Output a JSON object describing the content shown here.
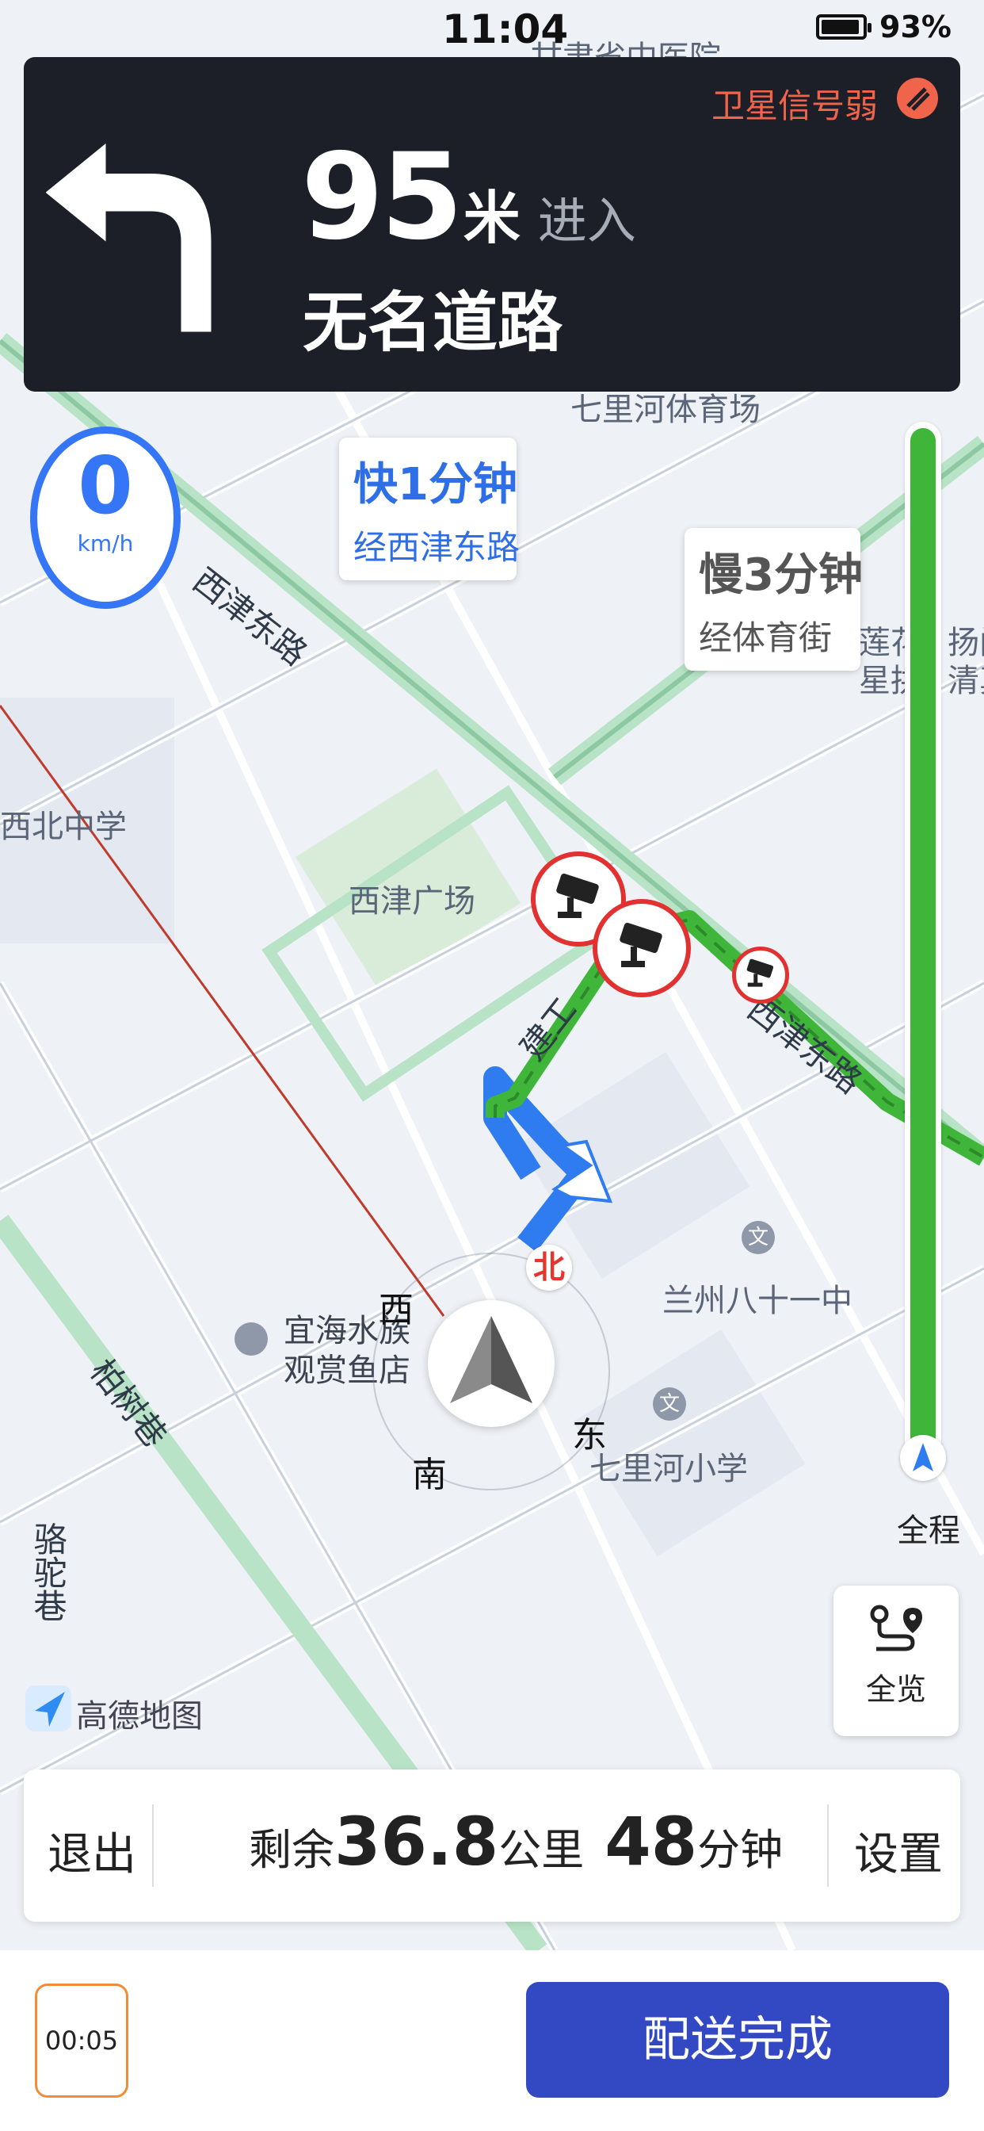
{
  "status_bar": {
    "time": "11:04",
    "battery": "93%",
    "battery_level": 0.93
  },
  "guidance": {
    "distance": "95",
    "distance_unit": "米",
    "action": "进入",
    "road_name": "无名道路",
    "gps_warning": "卫星信号弱",
    "turn_icon": "turn-left-icon"
  },
  "speed": {
    "value": "0",
    "unit": "km/h"
  },
  "route_options": [
    {
      "line1": "快1分钟",
      "line2": "经西津东路"
    },
    {
      "line1": "慢3分钟",
      "line2": "经体育街"
    }
  ],
  "map_labels": {
    "xijin_east_road_upper": "西津东路",
    "xijin_east_road_lower": "西津东路",
    "xijin_square": "西津广场",
    "northwest_middle_school": "西北中学",
    "jiangong": "建工",
    "baishu_lane": "柏树巷",
    "luotuo_lane": "骆驼巷",
    "aquarium_line1": "宜海水族",
    "aquarium_line2": "观赏鱼店",
    "lanzhou_81": "兰州八十一中",
    "qilihe_primary": "七里河小学",
    "qilihe_stadium": "七里河体育场",
    "hospital": "甘肃省中医院",
    "right_edge_1": "莲花",
    "right_edge_2": "星拱",
    "right_edge_3": "扬门",
    "right_edge_4": "清真"
  },
  "compass": {
    "north": "北",
    "south": "南",
    "east": "东",
    "west": "西"
  },
  "progress": {
    "label": "全程",
    "completed_fraction": 1.0
  },
  "overview_button": {
    "label": "全览"
  },
  "brand": {
    "name": "高德地图"
  },
  "info_bar": {
    "exit": "退出",
    "settings": "设置",
    "remain_prefix": "剩余",
    "distance": "36.8",
    "distance_unit": "公里",
    "time": "48",
    "time_unit": "分钟"
  },
  "footer": {
    "timer": "00:05",
    "complete_button": "配送完成"
  },
  "colors": {
    "guide_bg": "#1c1f27",
    "accent_blue": "#3476f6",
    "route_green": "#3fb63a",
    "warning_red": "#e13131",
    "primary_button": "#3349c4"
  }
}
